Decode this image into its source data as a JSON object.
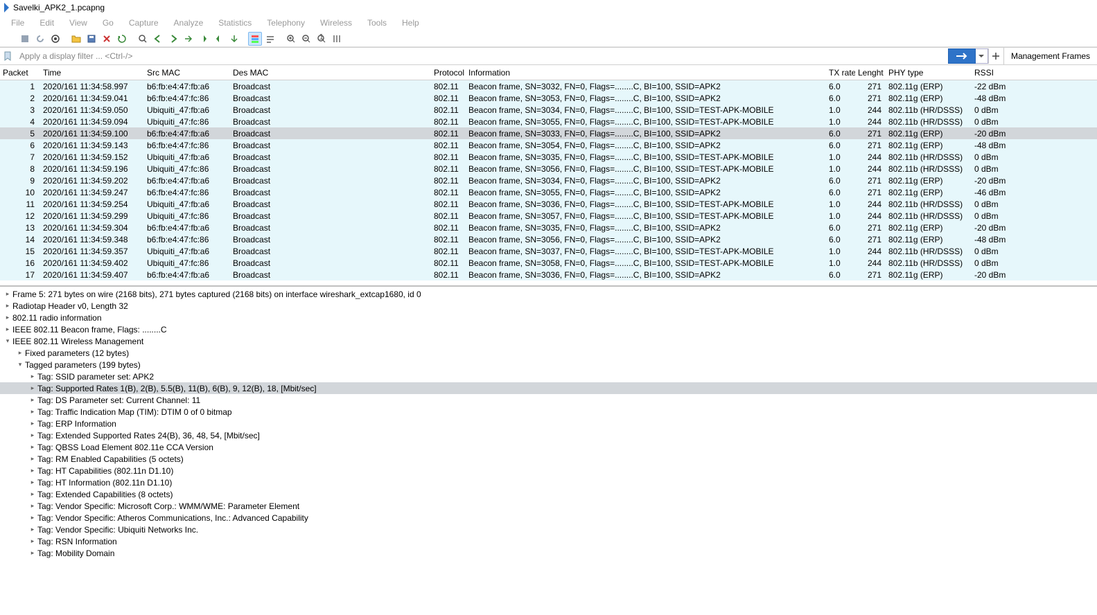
{
  "title": "Savelki_APK2_1.pcapng",
  "menu": [
    "File",
    "Edit",
    "View",
    "Go",
    "Capture",
    "Analyze",
    "Statistics",
    "Telephony",
    "Wireless",
    "Tools",
    "Help"
  ],
  "filter": {
    "placeholder": "Apply a display filter ... <Ctrl-/>",
    "mgmt_label": "Management Frames"
  },
  "columns": {
    "packet": "Packet",
    "time": "Time",
    "src": "Src MAC",
    "des": "Des MAC",
    "proto": "Protocol",
    "info": "Information",
    "tx": "TX rate",
    "len": "Lenght",
    "phy": "PHY type",
    "rssi": "RSSI"
  },
  "packets": [
    {
      "n": "1",
      "t": "2020/161 11:34:58.997",
      "s": "b6:fb:e4:47:fb:a6",
      "d": "Broadcast",
      "p": "802.11",
      "i": "Beacon frame, SN=3032, FN=0, Flags=........C, BI=100, SSID=APK2",
      "tx": "6.0",
      "l": "271",
      "phy": "802.11g (ERP)",
      "r": "-22 dBm"
    },
    {
      "n": "2",
      "t": "2020/161 11:34:59.041",
      "s": "b6:fb:e4:47:fc:86",
      "d": "Broadcast",
      "p": "802.11",
      "i": "Beacon frame, SN=3053, FN=0, Flags=........C, BI=100, SSID=APK2",
      "tx": "6.0",
      "l": "271",
      "phy": "802.11g (ERP)",
      "r": "-48 dBm"
    },
    {
      "n": "3",
      "t": "2020/161 11:34:59.050",
      "s": "Ubiquiti_47:fb:a6",
      "d": "Broadcast",
      "p": "802.11",
      "i": "Beacon frame, SN=3034, FN=0, Flags=........C, BI=100, SSID=TEST-APK-MOBILE",
      "tx": "1.0",
      "l": "244",
      "phy": "802.11b (HR/DSSS)",
      "r": "0 dBm"
    },
    {
      "n": "4",
      "t": "2020/161 11:34:59.094",
      "s": "Ubiquiti_47:fc:86",
      "d": "Broadcast",
      "p": "802.11",
      "i": "Beacon frame, SN=3055, FN=0, Flags=........C, BI=100, SSID=TEST-APK-MOBILE",
      "tx": "1.0",
      "l": "244",
      "phy": "802.11b (HR/DSSS)",
      "r": "0 dBm"
    },
    {
      "n": "5",
      "t": "2020/161 11:34:59.100",
      "s": "b6:fb:e4:47:fb:a6",
      "d": "Broadcast",
      "p": "802.11",
      "i": "Beacon frame, SN=3033, FN=0, Flags=........C, BI=100, SSID=APK2",
      "tx": "6.0",
      "l": "271",
      "phy": "802.11g (ERP)",
      "r": "-20 dBm",
      "sel": true
    },
    {
      "n": "6",
      "t": "2020/161 11:34:59.143",
      "s": "b6:fb:e4:47:fc:86",
      "d": "Broadcast",
      "p": "802.11",
      "i": "Beacon frame, SN=3054, FN=0, Flags=........C, BI=100, SSID=APK2",
      "tx": "6.0",
      "l": "271",
      "phy": "802.11g (ERP)",
      "r": "-48 dBm"
    },
    {
      "n": "7",
      "t": "2020/161 11:34:59.152",
      "s": "Ubiquiti_47:fb:a6",
      "d": "Broadcast",
      "p": "802.11",
      "i": "Beacon frame, SN=3035, FN=0, Flags=........C, BI=100, SSID=TEST-APK-MOBILE",
      "tx": "1.0",
      "l": "244",
      "phy": "802.11b (HR/DSSS)",
      "r": "0 dBm"
    },
    {
      "n": "8",
      "t": "2020/161 11:34:59.196",
      "s": "Ubiquiti_47:fc:86",
      "d": "Broadcast",
      "p": "802.11",
      "i": "Beacon frame, SN=3056, FN=0, Flags=........C, BI=100, SSID=TEST-APK-MOBILE",
      "tx": "1.0",
      "l": "244",
      "phy": "802.11b (HR/DSSS)",
      "r": "0 dBm"
    },
    {
      "n": "9",
      "t": "2020/161 11:34:59.202",
      "s": "b6:fb:e4:47:fb:a6",
      "d": "Broadcast",
      "p": "802.11",
      "i": "Beacon frame, SN=3034, FN=0, Flags=........C, BI=100, SSID=APK2",
      "tx": "6.0",
      "l": "271",
      "phy": "802.11g (ERP)",
      "r": "-20 dBm"
    },
    {
      "n": "10",
      "t": "2020/161 11:34:59.247",
      "s": "b6:fb:e4:47:fc:86",
      "d": "Broadcast",
      "p": "802.11",
      "i": "Beacon frame, SN=3055, FN=0, Flags=........C, BI=100, SSID=APK2",
      "tx": "6.0",
      "l": "271",
      "phy": "802.11g (ERP)",
      "r": "-46 dBm"
    },
    {
      "n": "11",
      "t": "2020/161 11:34:59.254",
      "s": "Ubiquiti_47:fb:a6",
      "d": "Broadcast",
      "p": "802.11",
      "i": "Beacon frame, SN=3036, FN=0, Flags=........C, BI=100, SSID=TEST-APK-MOBILE",
      "tx": "1.0",
      "l": "244",
      "phy": "802.11b (HR/DSSS)",
      "r": "0 dBm"
    },
    {
      "n": "12",
      "t": "2020/161 11:34:59.299",
      "s": "Ubiquiti_47:fc:86",
      "d": "Broadcast",
      "p": "802.11",
      "i": "Beacon frame, SN=3057, FN=0, Flags=........C, BI=100, SSID=TEST-APK-MOBILE",
      "tx": "1.0",
      "l": "244",
      "phy": "802.11b (HR/DSSS)",
      "r": "0 dBm"
    },
    {
      "n": "13",
      "t": "2020/161 11:34:59.304",
      "s": "b6:fb:e4:47:fb:a6",
      "d": "Broadcast",
      "p": "802.11",
      "i": "Beacon frame, SN=3035, FN=0, Flags=........C, BI=100, SSID=APK2",
      "tx": "6.0",
      "l": "271",
      "phy": "802.11g (ERP)",
      "r": "-20 dBm"
    },
    {
      "n": "14",
      "t": "2020/161 11:34:59.348",
      "s": "b6:fb:e4:47:fc:86",
      "d": "Broadcast",
      "p": "802.11",
      "i": "Beacon frame, SN=3056, FN=0, Flags=........C, BI=100, SSID=APK2",
      "tx": "6.0",
      "l": "271",
      "phy": "802.11g (ERP)",
      "r": "-48 dBm"
    },
    {
      "n": "15",
      "t": "2020/161 11:34:59.357",
      "s": "Ubiquiti_47:fb:a6",
      "d": "Broadcast",
      "p": "802.11",
      "i": "Beacon frame, SN=3037, FN=0, Flags=........C, BI=100, SSID=TEST-APK-MOBILE",
      "tx": "1.0",
      "l": "244",
      "phy": "802.11b (HR/DSSS)",
      "r": "0 dBm"
    },
    {
      "n": "16",
      "t": "2020/161 11:34:59.402",
      "s": "Ubiquiti_47:fc:86",
      "d": "Broadcast",
      "p": "802.11",
      "i": "Beacon frame, SN=3058, FN=0, Flags=........C, BI=100, SSID=TEST-APK-MOBILE",
      "tx": "1.0",
      "l": "244",
      "phy": "802.11b (HR/DSSS)",
      "r": "0 dBm"
    },
    {
      "n": "17",
      "t": "2020/161 11:34:59.407",
      "s": "b6:fb:e4:47:fb:a6",
      "d": "Broadcast",
      "p": "802.11",
      "i": "Beacon frame, SN=3036, FN=0, Flags=........C, BI=100, SSID=APK2",
      "tx": "6.0",
      "l": "271",
      "phy": "802.11g (ERP)",
      "r": "-20 dBm"
    }
  ],
  "detail": [
    {
      "ind": 0,
      "tg": ">",
      "txt": "Frame 5: 271 bytes on wire (2168 bits), 271 bytes captured (2168 bits) on interface wireshark_extcap1680, id 0"
    },
    {
      "ind": 0,
      "tg": ">",
      "txt": "Radiotap Header v0, Length 32"
    },
    {
      "ind": 0,
      "tg": ">",
      "txt": "802.11 radio information"
    },
    {
      "ind": 0,
      "tg": ">",
      "txt": "IEEE 802.11 Beacon frame, Flags: ........C"
    },
    {
      "ind": 0,
      "tg": "v",
      "txt": "IEEE 802.11 Wireless Management"
    },
    {
      "ind": 1,
      "tg": ">",
      "txt": "Fixed parameters (12 bytes)"
    },
    {
      "ind": 1,
      "tg": "v",
      "txt": "Tagged parameters (199 bytes)"
    },
    {
      "ind": 2,
      "tg": ">",
      "txt": "Tag: SSID parameter set: APK2"
    },
    {
      "ind": 2,
      "tg": ">",
      "txt": "Tag: Supported Rates 1(B), 2(B), 5.5(B), 11(B), 6(B), 9, 12(B), 18, [Mbit/sec]",
      "sel": true
    },
    {
      "ind": 2,
      "tg": ">",
      "txt": "Tag: DS Parameter set: Current Channel: 11"
    },
    {
      "ind": 2,
      "tg": ">",
      "txt": "Tag: Traffic Indication Map (TIM): DTIM 0 of 0 bitmap"
    },
    {
      "ind": 2,
      "tg": ">",
      "txt": "Tag: ERP Information"
    },
    {
      "ind": 2,
      "tg": ">",
      "txt": "Tag: Extended Supported Rates 24(B), 36, 48, 54, [Mbit/sec]"
    },
    {
      "ind": 2,
      "tg": ">",
      "txt": "Tag: QBSS Load Element 802.11e CCA Version"
    },
    {
      "ind": 2,
      "tg": ">",
      "txt": "Tag: RM Enabled Capabilities (5 octets)"
    },
    {
      "ind": 2,
      "tg": ">",
      "txt": "Tag: HT Capabilities (802.11n D1.10)"
    },
    {
      "ind": 2,
      "tg": ">",
      "txt": "Tag: HT Information (802.11n D1.10)"
    },
    {
      "ind": 2,
      "tg": ">",
      "txt": "Tag: Extended Capabilities (8 octets)"
    },
    {
      "ind": 2,
      "tg": ">",
      "txt": "Tag: Vendor Specific: Microsoft Corp.: WMM/WME: Parameter Element"
    },
    {
      "ind": 2,
      "tg": ">",
      "txt": "Tag: Vendor Specific: Atheros Communications, Inc.: Advanced Capability"
    },
    {
      "ind": 2,
      "tg": ">",
      "txt": "Tag: Vendor Specific: Ubiquiti Networks Inc."
    },
    {
      "ind": 2,
      "tg": ">",
      "txt": "Tag: RSN Information"
    },
    {
      "ind": 2,
      "tg": ">",
      "txt": "Tag: Mobility Domain"
    }
  ]
}
